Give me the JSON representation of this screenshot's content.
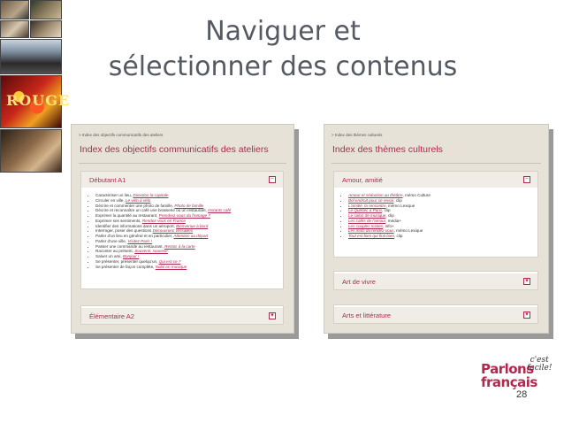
{
  "slide": {
    "title_line1": "Naviguer et",
    "title_line2": "sélectionner des contenus",
    "page_number": "28"
  },
  "left_panel": {
    "breadcrumb": "> Index des objectifs communicatifs des ateliers",
    "title": "Index des objectifs communicatifs des ateliers",
    "section1": "Débutant A1",
    "items": [
      {
        "text": "Caractériser un lieu,",
        "link": "Direction la capitale"
      },
      {
        "text": "Circuler en ville,",
        "link": "Le vélo à vélo"
      },
      {
        "text": "Décrire et commenter une photo de famille,",
        "link": "Photo de famille"
      },
      {
        "text": "Décrire et reconnaître un café une brasserie ou un restaurant,",
        "link": "Instants café"
      },
      {
        "text": "Exprimer la quantité au restaurant,",
        "link": "Prendrez-vous du fromage ?"
      },
      {
        "text": "Exprimer ses sentiments,",
        "link": "Rendez-vous en France"
      },
      {
        "text": "Identifier des informations dans un aéroport,",
        "link": "Bienvenue à bord"
      },
      {
        "text": "Interroger, poser des questions",
        "link": "Découvrons Versailles"
      },
      {
        "text": "Parler d'un lieu en général et en particulier,",
        "link": "Attention au départ"
      },
      {
        "text": "Parler d'une ville,",
        "link": "Visitez Paris !"
      },
      {
        "text": "Passer une commande au restaurant,",
        "link": "Restos à la carte"
      },
      {
        "text": "Raconter au présent,",
        "link": "Souvenir, souvenir"
      },
      {
        "text": "Saluer un ami,",
        "link": "Bonjour !"
      },
      {
        "text": "Se présenter, présenter quelqu'un,",
        "link": "Qui est-ce ?"
      },
      {
        "text": "Se présenter de façon complète,",
        "link": "Nabil en musique"
      }
    ],
    "section2": "Élémentaire A2"
  },
  "right_panel": {
    "breadcrumb": "> Index des thèmes culturels",
    "title": "Index des thèmes culturels",
    "section1": "Amour, amitié",
    "items": [
      {
        "link": "Amour et séduction au théâtre",
        "text": ", mémo Culture"
      },
      {
        "link": "Bel endroit pour se revoir",
        "text": ", clip"
      },
      {
        "link": "L'amitié, la rencontre",
        "text": ", mémo Lexique"
      },
      {
        "link": "Le Québec à Paris",
        "text": ", clip"
      },
      {
        "link": "Le salon de musique",
        "text": ", clip"
      },
      {
        "link": "Les cafés de l'amour",
        "text": ", média+"
      },
      {
        "link": "Les couples mixtes",
        "text": ", info+"
      },
      {
        "link": "Les mots du rendez-vous",
        "text": ", mémo Lexique"
      },
      {
        "link": "Tout est bien qui finit bien",
        "text": ", clip"
      }
    ],
    "section2": "Art de vivre",
    "section3": "Arts et littérature"
  },
  "logo": {
    "line1": "Parlons",
    "line2": "français",
    "tag1": "c'est",
    "tag2": "facile!"
  },
  "photo_strip": {
    "sign_text": "ROUGE"
  }
}
